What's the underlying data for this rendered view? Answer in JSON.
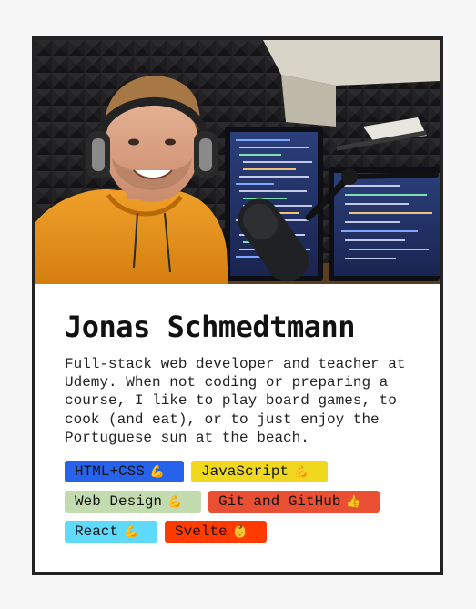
{
  "profile": {
    "name": "Jonas Schmedtmann",
    "bio": "Full-stack web developer and teacher at Udemy. When not coding or preparing a course, I like to play board games, to cook (and eat), or to just enjoy the Portuguese sun at the beach.",
    "photo_icon": "profile-photo"
  },
  "skills": [
    {
      "label": "HTML+CSS",
      "emoji": "💪",
      "color": "#2662ea"
    },
    {
      "label": "JavaScript",
      "emoji": "💪",
      "color": "#efd81d"
    },
    {
      "label": "Web Design",
      "emoji": "💪",
      "color": "#c3dcaf"
    },
    {
      "label": "Git and GitHub",
      "emoji": "👍",
      "color": "#e84f33"
    },
    {
      "label": "React",
      "emoji": "💪",
      "color": "#60dafb"
    },
    {
      "label": "Svelte",
      "emoji": "👶",
      "color": "#ff3b00"
    }
  ]
}
